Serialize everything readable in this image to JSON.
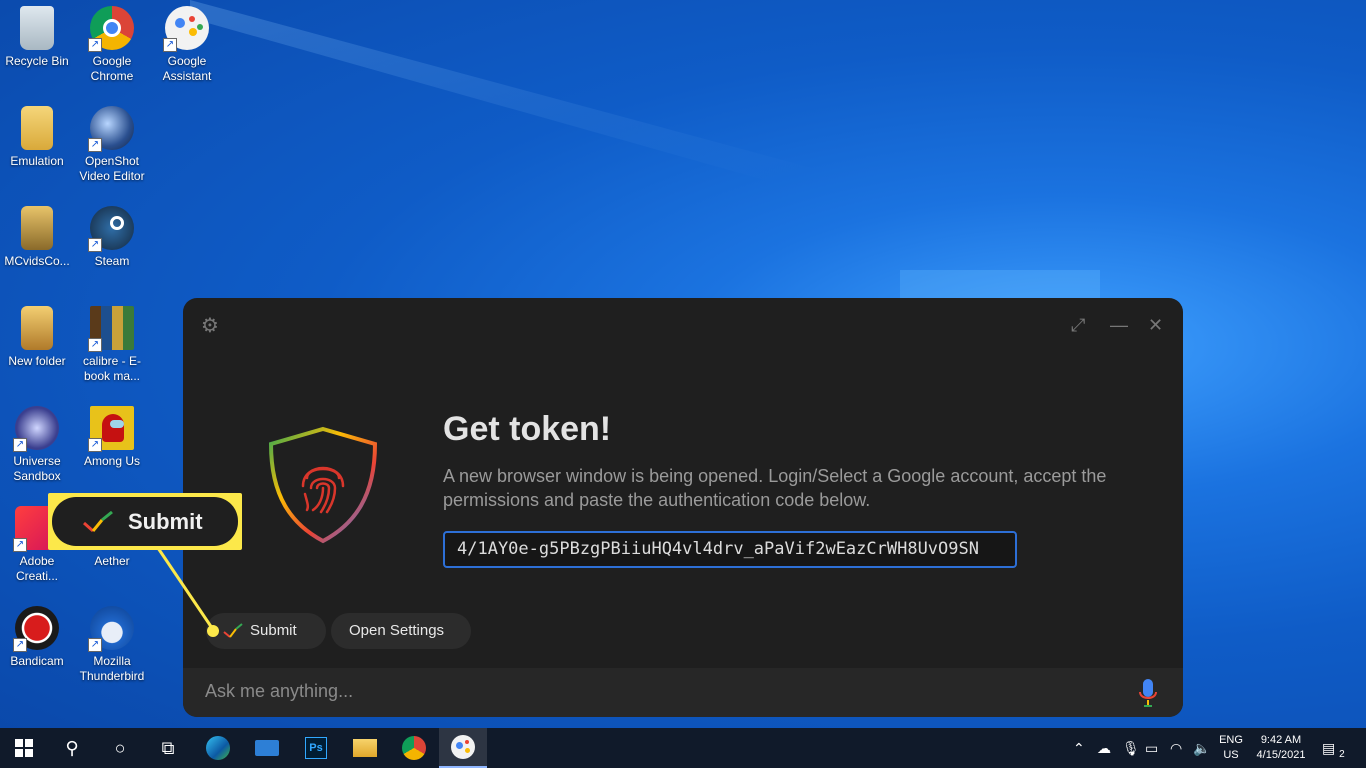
{
  "desktop": {
    "icons": [
      {
        "label": "Recycle Bin"
      },
      {
        "label": "Google Chrome"
      },
      {
        "label": "Google Assistant"
      },
      {
        "label": "Emulation"
      },
      {
        "label": "OpenShot Video Editor"
      },
      {
        "label": "MCvidsCo..."
      },
      {
        "label": "Steam"
      },
      {
        "label": "New folder"
      },
      {
        "label": "calibre - E-book ma..."
      },
      {
        "label": "Universe Sandbox"
      },
      {
        "label": "Among Us"
      },
      {
        "label": "Adobe Creati..."
      },
      {
        "label": "Aether"
      },
      {
        "label": "Bandicam"
      },
      {
        "label": "Mozilla Thunderbird"
      }
    ]
  },
  "assistant": {
    "title": "Get token!",
    "description": "A new browser window is being opened. Login/Select a Google account, accept the permissions and paste the authentication code below.",
    "code_value": "4/1AY0e-g5PBzgPBiiuHQ4vl4drv_aPaVif2wEazCrWH8UvO9SN",
    "submit_label": "Submit",
    "open_settings_label": "Open Settings",
    "ask_placeholder": "Ask me anything...",
    "icons": {
      "settings": "gear-icon",
      "maximize": "expand-icon",
      "minimize": "minimize-icon",
      "close": "close-icon",
      "mic": "microphone-icon",
      "shield": "fingerprint-shield-icon"
    }
  },
  "callout": {
    "label": "Submit",
    "color": "#fce84a"
  },
  "taskbar": {
    "lang_top": "ENG",
    "lang_bottom": "US",
    "time": "9:42 AM",
    "date": "4/15/2021",
    "notification_count": "2"
  },
  "colors": {
    "accent_blue": "#2d6fd6",
    "callout_yellow": "#fce84a"
  }
}
